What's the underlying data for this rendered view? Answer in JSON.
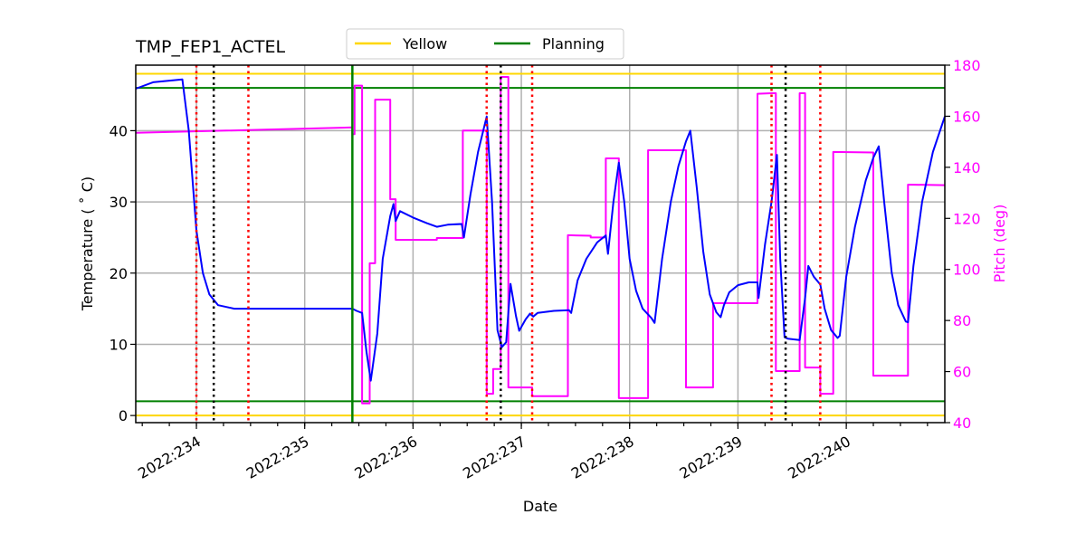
{
  "chart_data": {
    "type": "line",
    "title": "TMP_FEP1_ACTEL",
    "xlabel": "Date",
    "ylabel": "Temperature ($^\\circ$C)",
    "ylabel_display": "Temperature ( ˚ C)",
    "ylabel_right": "Pitch (deg)",
    "xlim": [
      233.44,
      240.91
    ],
    "ylim": [
      -1,
      49.2
    ],
    "ylim_right": [
      40,
      180
    ],
    "grid": true,
    "x_ticks": [
      {
        "value": 234,
        "label": "2022:234"
      },
      {
        "value": 235,
        "label": "2022:235"
      },
      {
        "value": 236,
        "label": "2022:236"
      },
      {
        "value": 237,
        "label": "2022:237"
      },
      {
        "value": 238,
        "label": "2022:238"
      },
      {
        "value": 239,
        "label": "2022:239"
      },
      {
        "value": 240,
        "label": "2022:240"
      }
    ],
    "x_minor_tick_step": 0.25,
    "y_ticks": [
      0,
      10,
      20,
      30,
      40
    ],
    "y_ticks_right": [
      40,
      60,
      80,
      100,
      120,
      140,
      160,
      180
    ],
    "legend": {
      "placement": "top-center",
      "entries": [
        {
          "label": "Yellow",
          "color": "#ffd700"
        },
        {
          "label": "Planning",
          "color": "#008000"
        }
      ]
    },
    "limits": [
      {
        "name": "yellow-high",
        "value": 48.0,
        "color": "#ffd700"
      },
      {
        "name": "yellow-low",
        "value": 0.0,
        "color": "#ffd700"
      },
      {
        "name": "planning-high",
        "value": 46.0,
        "color": "#008000"
      },
      {
        "name": "planning-low",
        "value": 2.0,
        "color": "#008000"
      }
    ],
    "vlines": [
      {
        "name": "red-dotted",
        "x": 234.0,
        "color": "#ff0000",
        "style": "dotted"
      },
      {
        "name": "black-dotted",
        "x": 234.16,
        "color": "#000000",
        "style": "dotted"
      },
      {
        "name": "red-dotted",
        "x": 234.48,
        "color": "#ff0000",
        "style": "dotted"
      },
      {
        "name": "green-solid",
        "x": 235.44,
        "color": "#008000",
        "style": "solid"
      },
      {
        "name": "red-dotted",
        "x": 236.68,
        "color": "#ff0000",
        "style": "dotted"
      },
      {
        "name": "black-dotted",
        "x": 236.81,
        "color": "#000000",
        "style": "dotted"
      },
      {
        "name": "red-dotted",
        "x": 237.1,
        "color": "#ff0000",
        "style": "dotted"
      },
      {
        "name": "red-dotted",
        "x": 239.31,
        "color": "#ff0000",
        "style": "dotted"
      },
      {
        "name": "black-dotted",
        "x": 239.44,
        "color": "#000000",
        "style": "dotted"
      },
      {
        "name": "red-dotted",
        "x": 239.76,
        "color": "#ff0000",
        "style": "dotted"
      }
    ],
    "series": [
      {
        "name": "Temperature",
        "axis": "left",
        "color": "#0000ff",
        "points": [
          [
            233.44,
            45.9
          ],
          [
            233.6,
            46.8
          ],
          [
            233.87,
            47.2
          ],
          [
            233.93,
            40.0
          ],
          [
            234.0,
            26.0
          ],
          [
            234.06,
            20.0
          ],
          [
            234.12,
            17.0
          ],
          [
            234.2,
            15.5
          ],
          [
            234.35,
            15.0
          ],
          [
            235.0,
            15.0
          ],
          [
            235.44,
            15.0
          ],
          [
            235.48,
            14.7
          ],
          [
            235.53,
            14.4
          ],
          [
            235.57,
            9.0
          ],
          [
            235.61,
            4.9
          ],
          [
            235.67,
            11.5
          ],
          [
            235.72,
            22.0
          ],
          [
            235.79,
            28.0
          ],
          [
            235.82,
            29.7
          ],
          [
            235.84,
            27.3
          ],
          [
            235.88,
            28.7
          ],
          [
            236.0,
            27.8
          ],
          [
            236.13,
            27.0
          ],
          [
            236.22,
            26.5
          ],
          [
            236.32,
            26.8
          ],
          [
            236.45,
            26.9
          ],
          [
            236.47,
            25.0
          ],
          [
            236.53,
            31.0
          ],
          [
            236.6,
            37.0
          ],
          [
            236.68,
            42.0
          ],
          [
            236.73,
            30.0
          ],
          [
            236.78,
            12.0
          ],
          [
            236.82,
            9.6
          ],
          [
            236.86,
            10.3
          ],
          [
            236.9,
            18.5
          ],
          [
            236.95,
            14.0
          ],
          [
            236.98,
            11.9
          ],
          [
            237.04,
            13.5
          ],
          [
            237.08,
            14.3
          ],
          [
            237.11,
            13.9
          ],
          [
            237.15,
            14.4
          ],
          [
            237.3,
            14.7
          ],
          [
            237.44,
            14.8
          ],
          [
            237.46,
            14.4
          ],
          [
            237.52,
            19.0
          ],
          [
            237.6,
            22.0
          ],
          [
            237.7,
            24.3
          ],
          [
            237.78,
            25.3
          ],
          [
            237.8,
            22.7
          ],
          [
            237.85,
            30.0
          ],
          [
            237.9,
            35.5
          ],
          [
            237.95,
            30.0
          ],
          [
            238.0,
            22.0
          ],
          [
            238.06,
            17.5
          ],
          [
            238.12,
            15.0
          ],
          [
            238.2,
            13.7
          ],
          [
            238.23,
            13.0
          ],
          [
            238.3,
            22.0
          ],
          [
            238.38,
            30.0
          ],
          [
            238.45,
            35.0
          ],
          [
            238.52,
            38.5
          ],
          [
            238.56,
            40.0
          ],
          [
            238.62,
            32.0
          ],
          [
            238.68,
            23.0
          ],
          [
            238.74,
            17.0
          ],
          [
            238.8,
            14.5
          ],
          [
            238.84,
            13.8
          ],
          [
            238.87,
            15.5
          ],
          [
            238.92,
            17.3
          ],
          [
            239.0,
            18.3
          ],
          [
            239.1,
            18.7
          ],
          [
            239.18,
            18.7
          ],
          [
            239.19,
            16.5
          ],
          [
            239.25,
            24.0
          ],
          [
            239.31,
            30.0
          ],
          [
            239.36,
            36.6
          ],
          [
            239.39,
            22.0
          ],
          [
            239.43,
            11.0
          ],
          [
            239.46,
            10.8
          ],
          [
            239.57,
            10.6
          ],
          [
            239.62,
            16.5
          ],
          [
            239.65,
            21.0
          ],
          [
            239.7,
            19.5
          ],
          [
            239.76,
            18.4
          ],
          [
            239.8,
            15.0
          ],
          [
            239.86,
            12.0
          ],
          [
            239.92,
            10.9
          ],
          [
            239.94,
            11.2
          ],
          [
            240.0,
            19.5
          ],
          [
            240.08,
            26.5
          ],
          [
            240.18,
            33.0
          ],
          [
            240.25,
            36.2
          ],
          [
            240.3,
            37.8
          ],
          [
            240.35,
            30.0
          ],
          [
            240.42,
            20.0
          ],
          [
            240.48,
            15.5
          ],
          [
            240.55,
            13.2
          ],
          [
            240.57,
            13.1
          ],
          [
            240.62,
            21.0
          ],
          [
            240.7,
            30.0
          ],
          [
            240.8,
            37.0
          ],
          [
            240.91,
            42.0
          ]
        ]
      },
      {
        "name": "Pitch",
        "axis": "right",
        "color": "#ff00ff",
        "points": [
          [
            233.44,
            153.5
          ],
          [
            235.44,
            155.6
          ],
          [
            235.44,
            153.0
          ],
          [
            235.46,
            153.0
          ],
          [
            235.46,
            172.0
          ],
          [
            235.53,
            172.0
          ],
          [
            235.53,
            47.5
          ],
          [
            235.6,
            47.5
          ],
          [
            235.6,
            102.4
          ],
          [
            235.65,
            102.4
          ],
          [
            235.65,
            166.5
          ],
          [
            235.79,
            166.5
          ],
          [
            235.79,
            127.5
          ],
          [
            235.84,
            127.5
          ],
          [
            235.84,
            111.6
          ],
          [
            236.22,
            111.6
          ],
          [
            236.22,
            112.3
          ],
          [
            236.46,
            112.3
          ],
          [
            236.46,
            154.4
          ],
          [
            236.68,
            154.4
          ],
          [
            236.68,
            51.3
          ],
          [
            236.74,
            51.3
          ],
          [
            236.74,
            61.0
          ],
          [
            236.81,
            61.0
          ],
          [
            236.81,
            175.4
          ],
          [
            236.88,
            175.4
          ],
          [
            236.88,
            53.8
          ],
          [
            237.1,
            53.8
          ],
          [
            237.1,
            50.4
          ],
          [
            237.43,
            50.4
          ],
          [
            237.43,
            113.4
          ],
          [
            237.64,
            113.2
          ],
          [
            237.64,
            112.5
          ],
          [
            237.78,
            112.5
          ],
          [
            237.78,
            143.5
          ],
          [
            237.9,
            143.5
          ],
          [
            237.9,
            49.6
          ],
          [
            238.17,
            49.6
          ],
          [
            238.17,
            146.7
          ],
          [
            238.52,
            146.7
          ],
          [
            238.52,
            53.8
          ],
          [
            238.77,
            53.8
          ],
          [
            238.77,
            86.8
          ],
          [
            239.18,
            86.8
          ],
          [
            239.18,
            168.8
          ],
          [
            239.31,
            169.0
          ],
          [
            239.35,
            169.0
          ],
          [
            239.35,
            60.2
          ],
          [
            239.57,
            60.2
          ],
          [
            239.57,
            169.0
          ],
          [
            239.62,
            169.0
          ],
          [
            239.62,
            61.6
          ],
          [
            239.76,
            61.6
          ],
          [
            239.76,
            51.3
          ],
          [
            239.88,
            51.3
          ],
          [
            239.88,
            146.0
          ],
          [
            240.25,
            145.8
          ],
          [
            240.25,
            58.4
          ],
          [
            240.57,
            58.4
          ],
          [
            240.57,
            133.2
          ],
          [
            240.91,
            133.0
          ]
        ]
      }
    ]
  }
}
